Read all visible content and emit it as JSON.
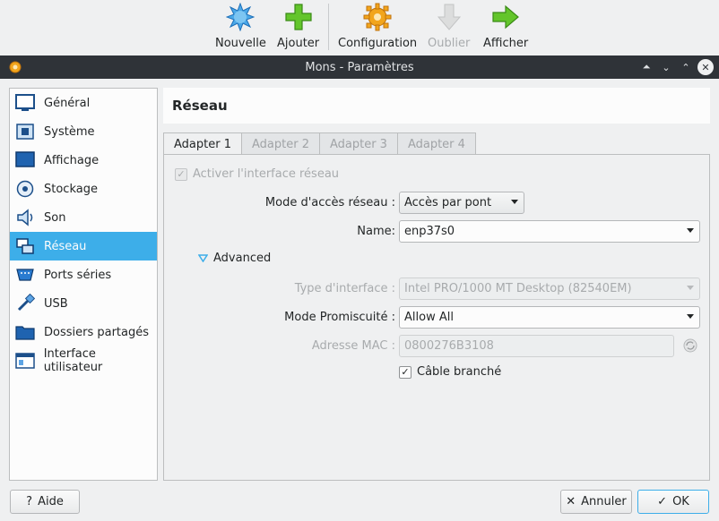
{
  "toolbar": {
    "buttons": [
      {
        "label": "Nouvelle",
        "icon": "new-star-icon",
        "enabled": true
      },
      {
        "label": "Ajouter",
        "icon": "add-plus-icon",
        "enabled": true
      },
      {
        "label": "Configuration",
        "icon": "settings-gear-icon",
        "enabled": true
      },
      {
        "label": "Oublier",
        "icon": "discard-arrow-icon",
        "enabled": false
      },
      {
        "label": "Afficher",
        "icon": "show-arrow-icon",
        "enabled": true
      }
    ]
  },
  "window": {
    "title": "Mons - Paramètres"
  },
  "sidebar": {
    "items": [
      {
        "label": "Général",
        "icon": "general-icon"
      },
      {
        "label": "Système",
        "icon": "system-chip-icon"
      },
      {
        "label": "Affichage",
        "icon": "display-monitor-icon"
      },
      {
        "label": "Stockage",
        "icon": "storage-disk-icon"
      },
      {
        "label": "Son",
        "icon": "audio-speaker-icon"
      },
      {
        "label": "Réseau",
        "icon": "network-icon",
        "active": true
      },
      {
        "label": "Ports séries",
        "icon": "serial-port-icon"
      },
      {
        "label": "USB",
        "icon": "usb-icon"
      },
      {
        "label": "Dossiers partagés",
        "icon": "shared-folder-icon"
      },
      {
        "label": "Interface utilisateur",
        "icon": "user-interface-icon"
      }
    ]
  },
  "page": {
    "title": "Réseau"
  },
  "tabs": [
    {
      "label": "Adapter 1",
      "active": true
    },
    {
      "label": "Adapter 2",
      "active": false
    },
    {
      "label": "Adapter 3",
      "active": false
    },
    {
      "label": "Adapter 4",
      "active": false
    }
  ],
  "form": {
    "enable_label": "Activer l'interface réseau",
    "enable_checked": true,
    "mode_label": "Mode d'accès réseau :",
    "mode_value": "Accès par pont",
    "name_label": "Name:",
    "name_value": "enp37s0",
    "advanced_label": "Advanced",
    "type_label": "Type d'interface :",
    "type_value": "Intel PRO/1000 MT Desktop (82540EM)",
    "promisc_label": "Mode Promiscuité :",
    "promisc_value": "Allow All",
    "mac_label": "Adresse MAC :",
    "mac_value": "0800276B3108",
    "cable_label": "Câble branché",
    "cable_checked": true
  },
  "buttons": {
    "help": "Aide",
    "cancel": "Annuler",
    "ok": "OK"
  },
  "colors": {
    "accent": "#3daee9",
    "titlebar": "#2f3338",
    "background": "#eff0f1"
  }
}
